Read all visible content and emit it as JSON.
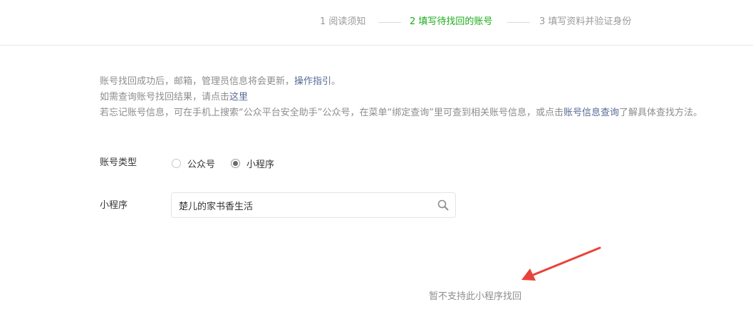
{
  "steps": [
    {
      "label": "1 阅读须知",
      "active": false
    },
    {
      "label": "2 填写待找回的账号",
      "active": true
    },
    {
      "label": "3 填写资料并验证身份",
      "active": false
    }
  ],
  "notice": {
    "line1_text": "账号找回成功后，邮箱，管理员信息将会更新，",
    "line1_link": "操作指引",
    "line1_end": "。",
    "line2_text": "如需查询账号找回结果，请点击",
    "line2_link": "这里",
    "line3_text": "若忘记账号信息，可在手机上搜索“公众平台安全助手”公众号，在菜单“绑定查询”里可查到相关账号信息，或点击",
    "line3_link": "账号信息查询",
    "line3_end": "了解具体查找方法。"
  },
  "form": {
    "account_type_label": "账号类型",
    "account_type_options": [
      {
        "label": "公众号",
        "checked": false
      },
      {
        "label": "小程序",
        "checked": true
      }
    ],
    "miniprogram_label": "小程序",
    "search_value": "楚儿的家书香生活"
  },
  "empty_tip": "暂不支持此小程序找回",
  "colors": {
    "accent": "#1aad19",
    "link": "#576b95",
    "muted": "#8d8d8d",
    "annotation_arrow": "#e8433a"
  },
  "icons": {
    "search": "search-icon",
    "annotation": "red-arrow-icon"
  }
}
